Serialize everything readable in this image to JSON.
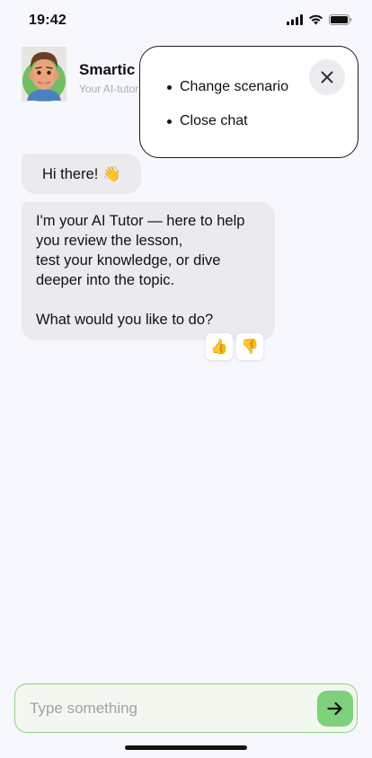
{
  "status_bar": {
    "time": "19:42",
    "icons": [
      "cellular-signal-icon",
      "wifi-icon",
      "battery-icon"
    ]
  },
  "header": {
    "avatar_icon": "memoji-avatar-icon",
    "name": "Smartic",
    "subtitle": "Your AI-tutor"
  },
  "menu": {
    "items": [
      {
        "label": "Change scenario"
      },
      {
        "label": "Close chat"
      }
    ],
    "close_icon": "close-icon"
  },
  "messages": [
    {
      "text": "Hi there! 👋"
    },
    {
      "paragraphs": [
        "I'm your AI Tutor — here to help\nyou review the lesson,\ntest your knowledge, or dive\ndeeper into the topic.",
        "What would you like to do?"
      ]
    }
  ],
  "feedback": {
    "thumbs_up": "👍",
    "thumbs_down": "👎"
  },
  "input": {
    "placeholder": "Type something",
    "value": "",
    "send_icon": "arrow-right-icon"
  },
  "colors": {
    "background": "#f7f8fd",
    "bubble": "#ebebef",
    "input_border": "#8fd082",
    "input_background": "#f2f8ef",
    "send_button": "#7ed17a"
  }
}
